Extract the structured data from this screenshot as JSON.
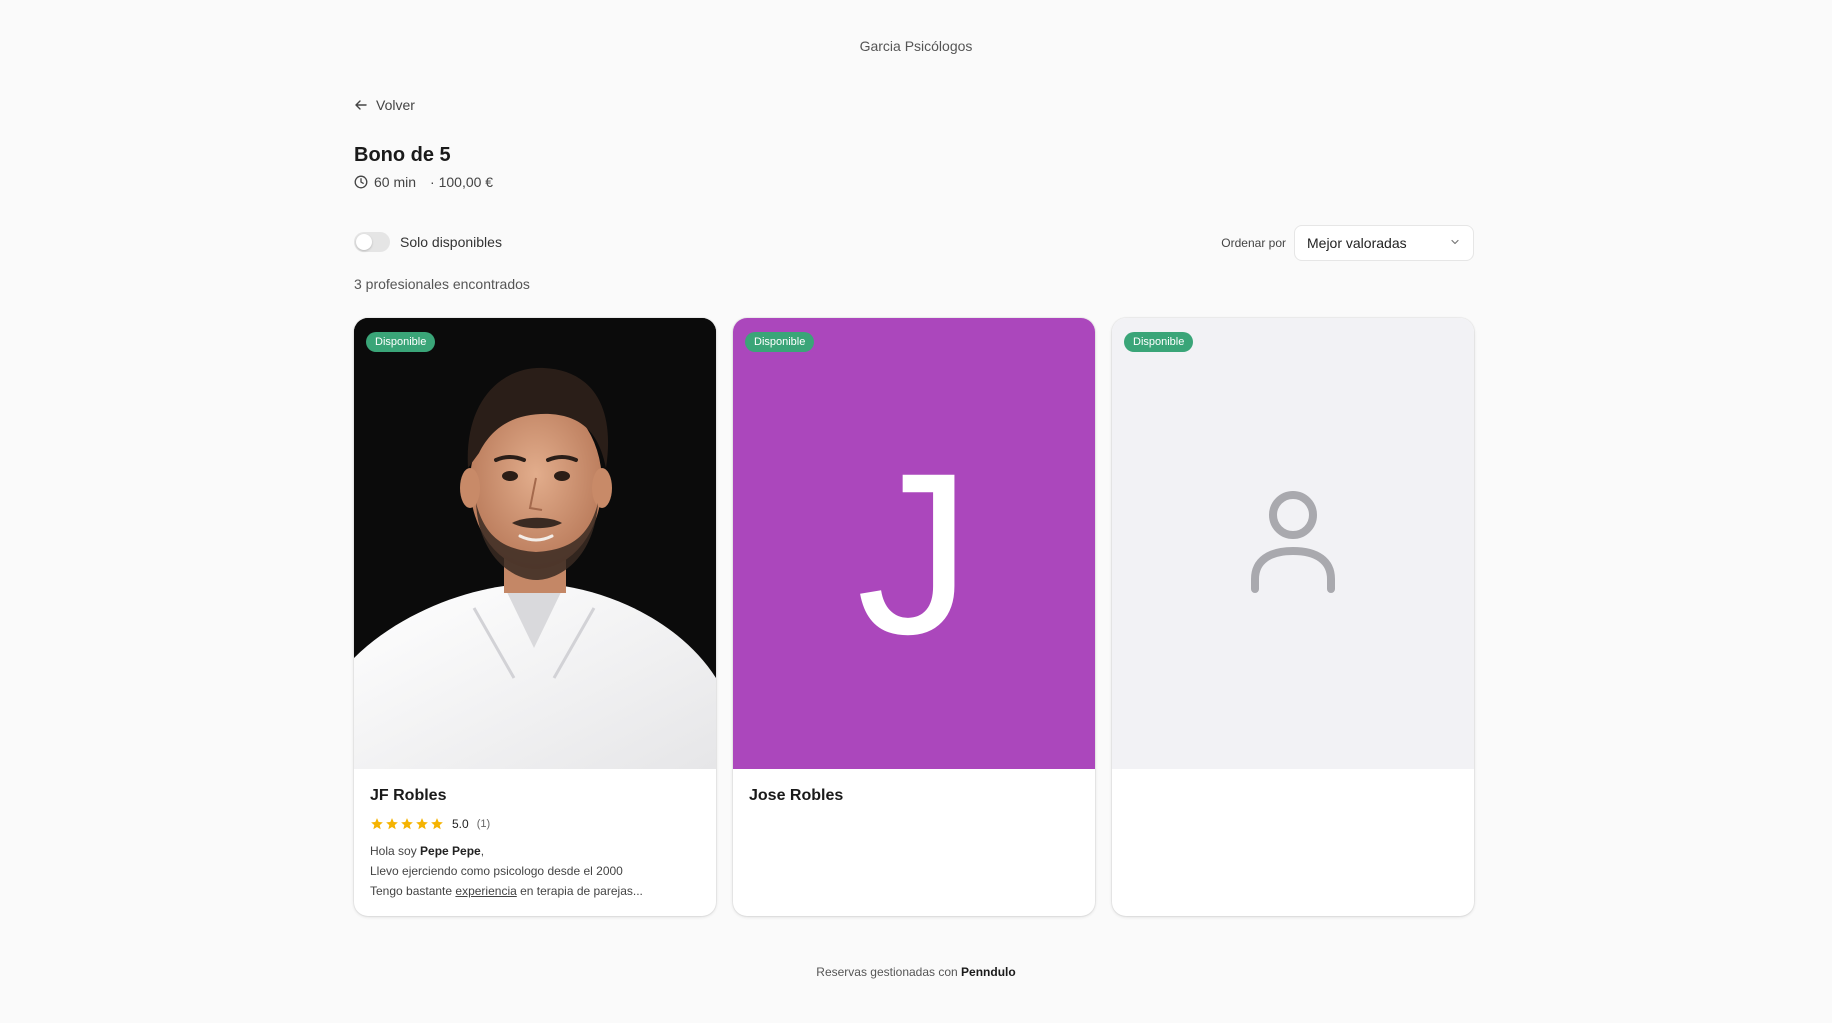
{
  "header": {
    "brand": "Garcia Psicólogos"
  },
  "nav": {
    "back_label": "Volver"
  },
  "service": {
    "title": "Bono de 5",
    "duration": "60 min",
    "price": "· 100,00 €"
  },
  "filters": {
    "only_available_label": "Solo disponibles",
    "only_available": false,
    "sort_label": "Ordenar por",
    "sort_value": "Mejor valoradas"
  },
  "results": {
    "count_text": "3 profesionales encontrados"
  },
  "professionals": [
    {
      "badge": "Disponible",
      "name": "JF Robles",
      "media": "photo",
      "rating": {
        "score": "5.0",
        "reviews": "(1)",
        "stars": 5
      },
      "bio": {
        "line1_prefix": "Hola soy ",
        "line1_bold": "Pepe Pepe",
        "line1_suffix": ",",
        "line2": "Llevo ejerciendo como psicologo desde el 2000",
        "line3_prefix": "Tengo bastante ",
        "line3_underline": "experiencia",
        "line3_suffix": " en terapia de parejas..."
      }
    },
    {
      "badge": "Disponible",
      "name": "Jose Robles",
      "media": "letter",
      "initial": "J"
    },
    {
      "badge": "Disponible",
      "name": "",
      "media": "placeholder"
    }
  ],
  "footer": {
    "prefix": "Reservas gestionadas con ",
    "brand": "Penndulo"
  },
  "colors": {
    "badge_green": "#3aa578",
    "avatar_purple": "#ab47bc",
    "star_gold": "#f5b301",
    "placeholder_bg": "#f2f2f5",
    "placeholder_icon": "#a9a9ae"
  },
  "icons": {
    "back": "arrow-left-icon",
    "duration": "clock-icon",
    "sort": "chevron-down-icon",
    "placeholder": "user-icon",
    "rating": "star-icon"
  }
}
